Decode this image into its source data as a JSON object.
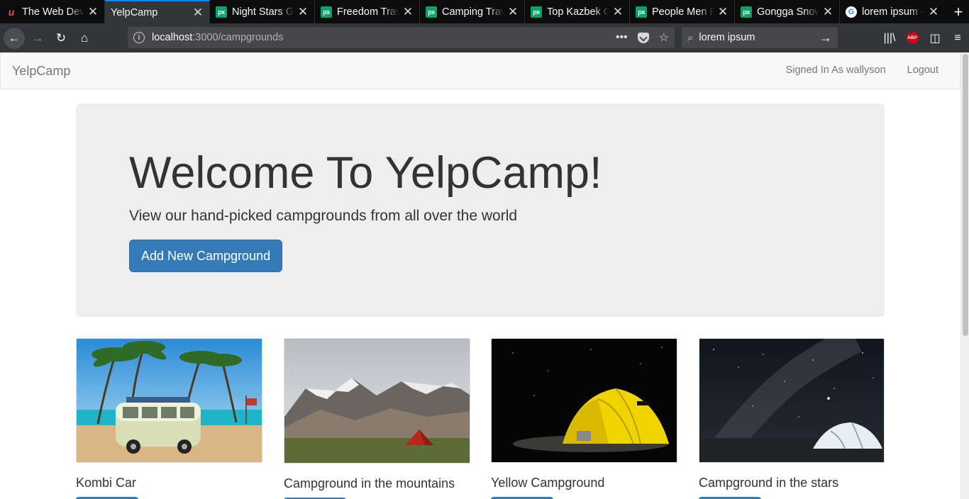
{
  "browser": {
    "tabs": [
      {
        "title": "The Web Developer Bootcamp",
        "icon": "udemy-icon",
        "active": false
      },
      {
        "title": "YelpCamp",
        "icon": "none",
        "active": true
      },
      {
        "title": "Night Stars Galaxy",
        "icon": "pixabay-icon",
        "active": false
      },
      {
        "title": "Freedom Travel",
        "icon": "pixabay-icon",
        "active": false
      },
      {
        "title": "Camping Travel",
        "icon": "pixabay-icon",
        "active": false
      },
      {
        "title": "Top Kazbek Georgia",
        "icon": "pixabay-icon",
        "active": false
      },
      {
        "title": "People Men Photo",
        "icon": "pixabay-icon",
        "active": false
      },
      {
        "title": "Gongga Snow Mountain",
        "icon": "pixabay-icon",
        "active": false
      },
      {
        "title": "lorem ipsum - Google",
        "icon": "google-icon",
        "active": false
      }
    ],
    "url": {
      "host": "localhost",
      "path": ":3000/campgrounds"
    },
    "search_value": "lorem ipsum"
  },
  "site": {
    "brand": "YelpCamp",
    "signed_in": "Signed In As wallyson",
    "logout": "Logout"
  },
  "jumbotron": {
    "heading": "Welcome To YelpCamp!",
    "lead": "View our hand-picked campgrounds from all over the world",
    "button": "Add New Campground"
  },
  "campgrounds": [
    {
      "name": "Kombi Car",
      "image": "kombi-van-beach"
    },
    {
      "name": "Campground in the mountains",
      "image": "mountain-tent"
    },
    {
      "name": "Yellow Campground",
      "image": "yellow-tent-night"
    },
    {
      "name": "Campground in the stars",
      "image": "tent-starry-sky"
    }
  ],
  "colors": {
    "primary": "#337ab7",
    "jumbotron_bg": "#eeeeee",
    "navbar_bg": "#f8f8f8",
    "tab_active_accent": "#0a84ff"
  }
}
